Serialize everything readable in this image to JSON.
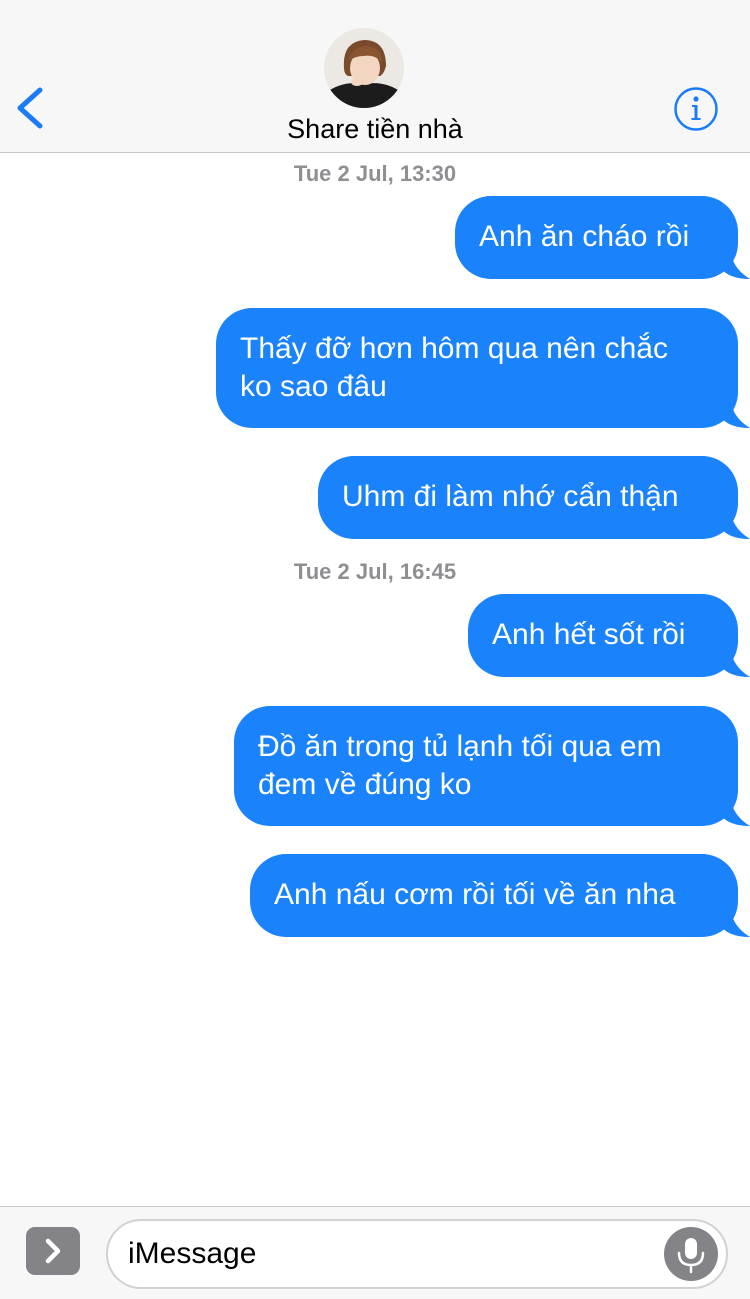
{
  "header": {
    "contact_name": "Share tiền nhà"
  },
  "messages": [
    {
      "timestamp": "Tue 2 Jul, 13:30"
    },
    {
      "text": "Anh ăn cháo rồi"
    },
    {
      "text": "Thấy đỡ hơn hôm qua nên chắc\nko sao đâu"
    },
    {
      "text": "Uhm đi làm nhớ cẩn thận"
    },
    {
      "timestamp": "Tue 2 Jul, 16:45"
    },
    {
      "text": "Anh hết sốt rồi"
    },
    {
      "text": "Đồ ăn trong tủ lạnh tối qua em\nđem về đúng ko"
    },
    {
      "text": "Anh nấu cơm rồi tối về ăn nha"
    }
  ],
  "composer": {
    "placeholder": "iMessage"
  },
  "icons": {
    "back": "chevron-left-icon",
    "info": "info-icon",
    "expand": "chevron-right-icon",
    "mic": "microphone-icon"
  },
  "colors": {
    "accent": "#1a82fb",
    "bubble_sent": "#1a82fb",
    "timestamp_text": "#8e8e93",
    "header_bg": "#f7f7f7"
  }
}
